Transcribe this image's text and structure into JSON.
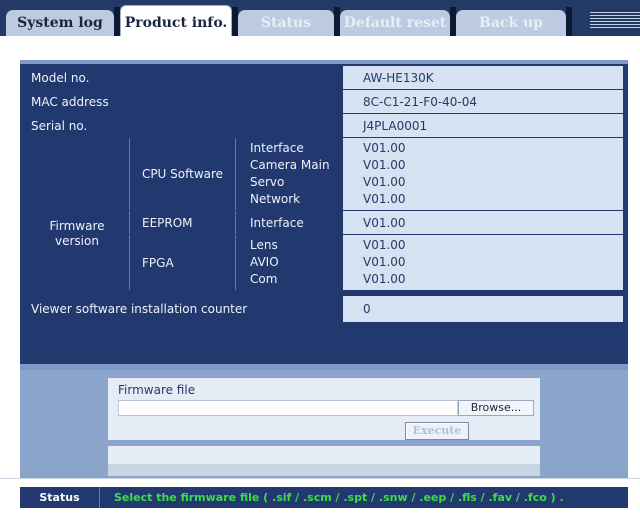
{
  "tabs": [
    {
      "label": "System log",
      "active": false
    },
    {
      "label": "Product info.",
      "active": true
    },
    {
      "label": "Status",
      "active": false
    },
    {
      "label": "Default reset",
      "active": false
    },
    {
      "label": "Back up",
      "active": false
    }
  ],
  "product_info": {
    "model_label": "Model no.",
    "model_value": "AW-HE130K",
    "mac_label": "MAC address",
    "mac_value": "8C-C1-21-F0-40-04",
    "serial_label": "Serial no.",
    "serial_value": "J4PLA0001",
    "firmware_label_line1": "Firmware",
    "firmware_label_line2": "version",
    "cpu_label": "CPU Software",
    "cpu_items": [
      {
        "name": "Interface",
        "version": "V01.00"
      },
      {
        "name": "Camera Main",
        "version": "V01.00"
      },
      {
        "name": "Servo",
        "version": "V01.00"
      },
      {
        "name": "Network",
        "version": "V01.00"
      }
    ],
    "eeprom_label": "EEPROM",
    "eeprom_items": [
      {
        "name": "Interface",
        "version": "V01.00"
      }
    ],
    "fpga_label": "FPGA",
    "fpga_items": [
      {
        "name": "Lens",
        "version": "V01.00"
      },
      {
        "name": "AVIO",
        "version": "V01.00"
      },
      {
        "name": "Com",
        "version": "V01.00"
      }
    ],
    "counter_label": "Viewer software installation counter",
    "counter_value": "0"
  },
  "firmware_update": {
    "file_label": "Firmware file",
    "file_value": "",
    "browse_label": "Browse...",
    "execute_label": "Execute"
  },
  "status": {
    "label": "Status",
    "message": "Select the firmware file ( .sif / .scm / .spt / .snw / .eep / .fls / .fav / .fco ) ."
  },
  "colors": {
    "tabbar": "#233a66",
    "panel": "#7f9ac6",
    "table_bg": "#223970",
    "value_cell": "#d6e1f2",
    "status_text": "#3ddc4a"
  }
}
